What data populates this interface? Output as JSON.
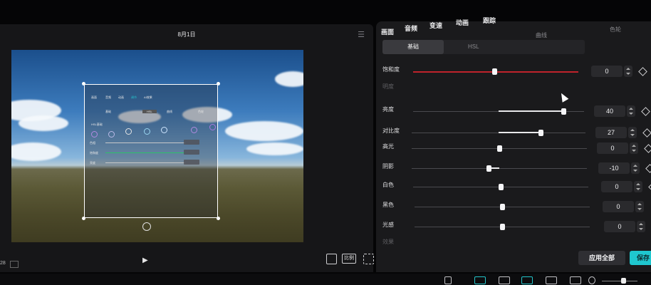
{
  "preview": {
    "title": "8月1日",
    "ratio_label": "比例",
    "time_left": "28"
  },
  "overlay": {
    "tabs": [
      "画面",
      "音频",
      "动画",
      "调节",
      "AI效果"
    ],
    "subtabs": [
      "基础",
      "HSL",
      "曲线",
      "色轮"
    ],
    "hsl_label": "HSL基础",
    "rows": [
      "色相",
      "饱和度",
      "亮度"
    ]
  },
  "adjust": {
    "tabs": [
      "画面",
      "音频",
      "变速",
      "动画",
      "跟踪"
    ],
    "subtabs": [
      "曲线",
      "色轮"
    ],
    "segments": [
      "基础",
      "HSL"
    ],
    "sliders": [
      {
        "label": "饱和度",
        "value": "0",
        "fraction": 0.49
      },
      {
        "label": "明度",
        "value": "",
        "fraction": 0,
        "dim": true
      },
      {
        "label": "亮度",
        "value": "40",
        "fraction": 0.88
      },
      {
        "label": "对比度",
        "value": "27",
        "fraction": 0.74
      },
      {
        "label": "高光",
        "value": "0",
        "fraction": 0.5
      },
      {
        "label": "阴影",
        "value": "-10",
        "fraction": 0.44
      },
      {
        "label": "白色",
        "value": "0",
        "fraction": 0.5
      },
      {
        "label": "黑色",
        "value": "0",
        "fraction": 0.5
      },
      {
        "label": "光感",
        "value": "0",
        "fraction": 0.5
      },
      {
        "label": "效果",
        "value": "",
        "fraction": 0,
        "dim": true
      }
    ],
    "apply_all": "应用全部",
    "save": "保存"
  },
  "colors": {
    "accent": "#1fc7cf",
    "saturation_track": "#c0232b"
  }
}
